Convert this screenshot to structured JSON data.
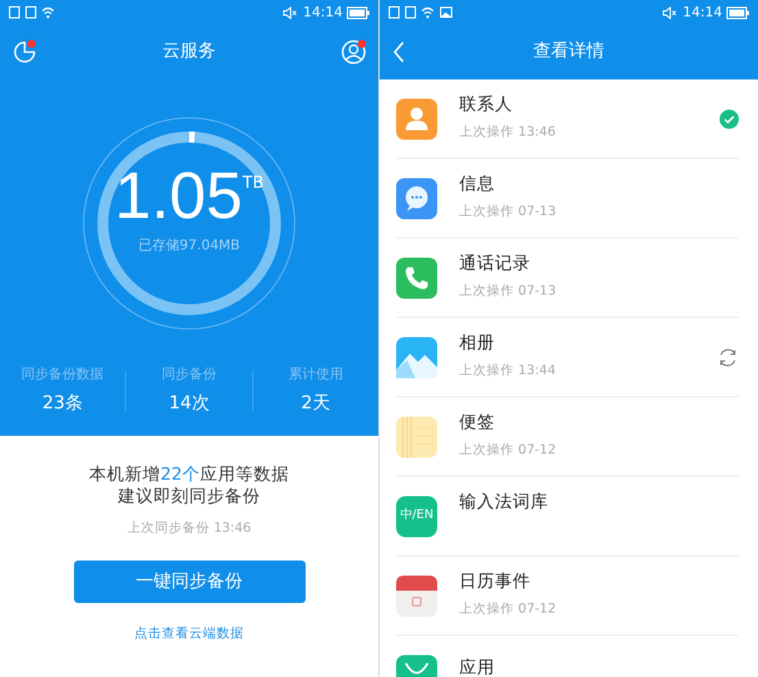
{
  "left_screen": {
    "status_bar": {
      "time": "14:14"
    },
    "header": {
      "title": "云服务",
      "left_badge": true,
      "right_badge": true
    },
    "storage": {
      "value": "1.05",
      "unit": "TB",
      "caption": "已存储97.04MB",
      "level": 0.01
    },
    "stats": [
      {
        "label": "同步备份数据",
        "value": "23条"
      },
      {
        "label": "同步备份",
        "value": "14次"
      },
      {
        "label": "累计使用",
        "value": "2天"
      }
    ],
    "notice": {
      "line_1": {
        "before": "本机新增",
        "highlight": "22个",
        "after": "应用等数据"
      },
      "line_2": "建议即刻同步备份",
      "last_sync": "上次同步备份 13:46"
    },
    "primary_button": "一键同步备份",
    "link": "点击查看云端数据"
  },
  "right_screen": {
    "status_bar": {
      "time": "14:14"
    },
    "header": {
      "title": "查看详情"
    },
    "items": [
      {
        "kind": "contacts",
        "name": "联系人",
        "subtitle": "上次操作 13:46",
        "synced": true,
        "syncing": false
      },
      {
        "kind": "messages",
        "name": "信息",
        "subtitle": "上次操作 07-13",
        "synced": false,
        "syncing": false
      },
      {
        "kind": "calls",
        "name": "通话记录",
        "subtitle": "上次操作 07-13",
        "synced": false,
        "syncing": false
      },
      {
        "kind": "gallery",
        "name": "相册",
        "subtitle": "上次操作 13:44",
        "synced": false,
        "syncing": true
      },
      {
        "kind": "notes",
        "name": "便签",
        "subtitle": "上次操作 07-12",
        "synced": false,
        "syncing": false
      },
      {
        "kind": "input",
        "name": "输入法词库",
        "icon_text": "中/EN",
        "synced": false,
        "syncing": false
      },
      {
        "kind": "calendar",
        "name": "日历事件",
        "subtitle": "上次操作 07-12",
        "synced": false,
        "syncing": false
      },
      {
        "kind": "apps",
        "name": "应用",
        "synced": false,
        "syncing": false
      }
    ]
  }
}
